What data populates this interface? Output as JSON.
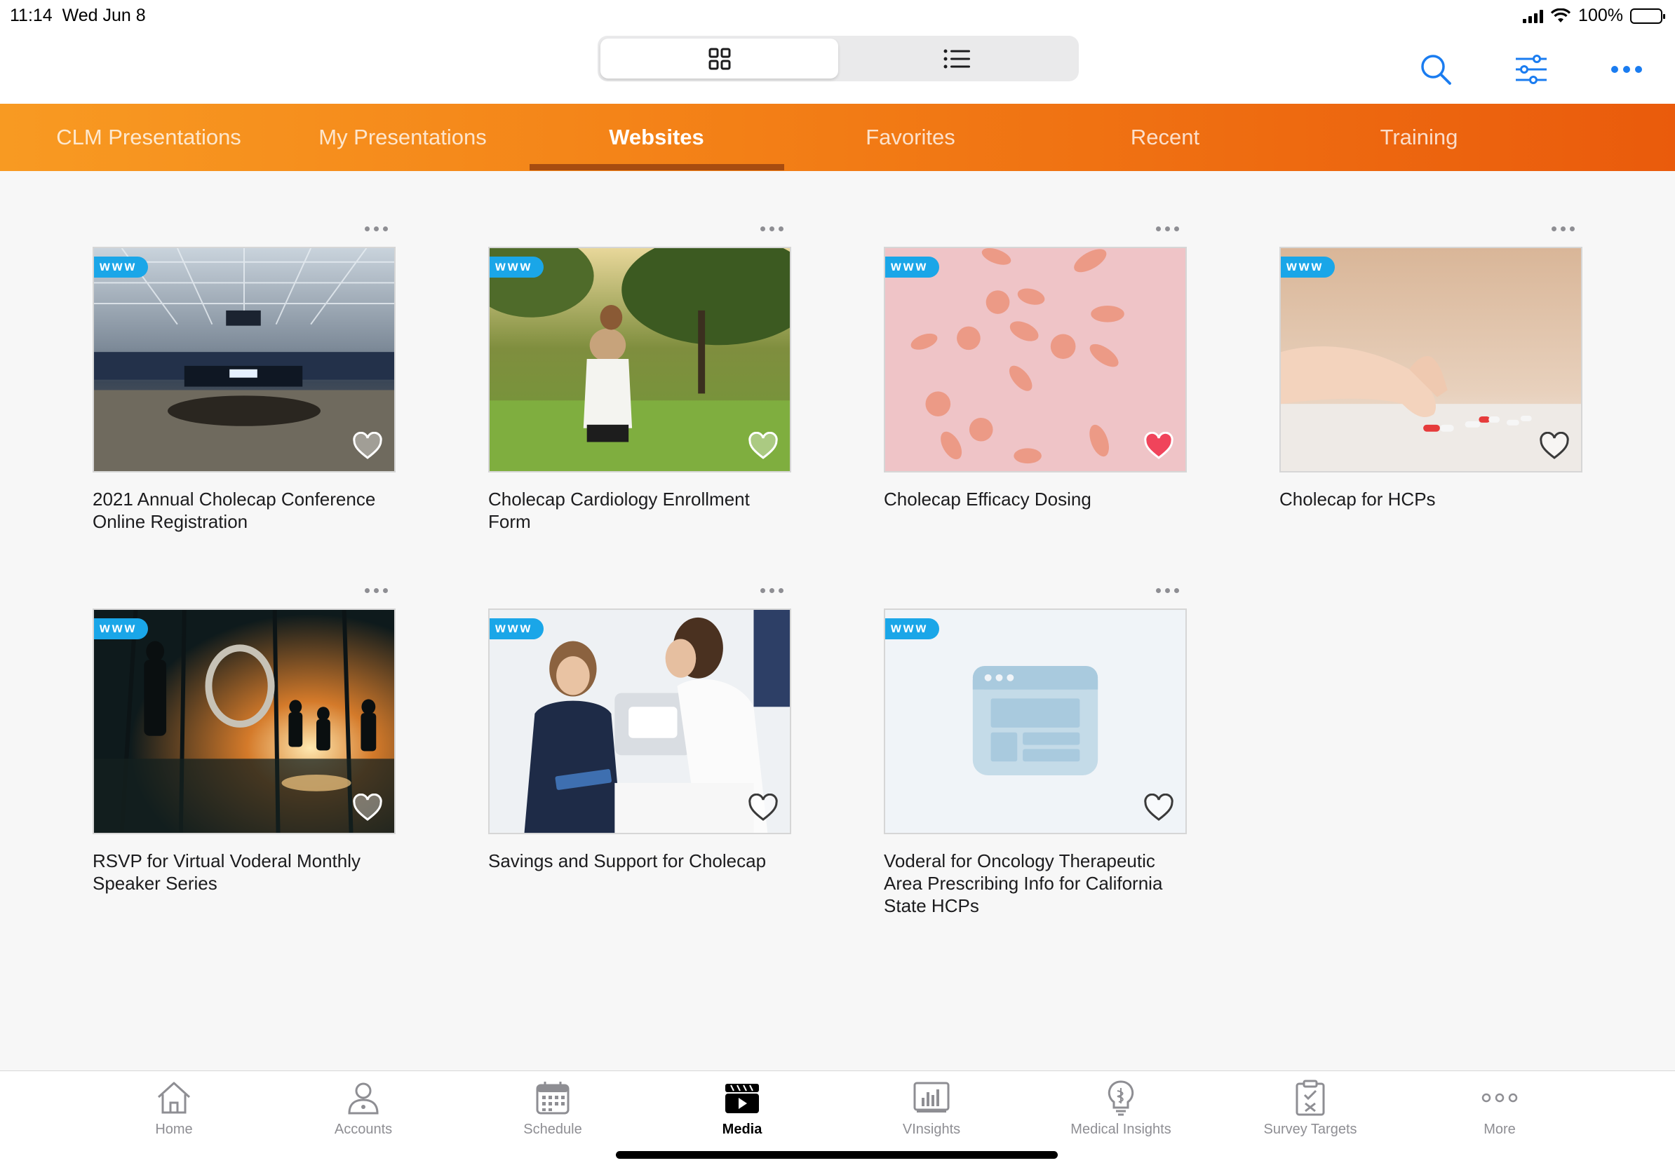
{
  "status": {
    "time": "11:14",
    "date": "Wed Jun 8",
    "battery": "100%"
  },
  "view_toggle": {
    "grid_icon": "grid-icon",
    "list_icon": "list-icon",
    "selected": "grid"
  },
  "header_actions": {
    "search_icon": "search-icon",
    "filter_icon": "sliders-icon",
    "more_icon": "ellipsis-icon",
    "accent": "#1a7cf0"
  },
  "tabs": [
    {
      "label": "CLM Presentations"
    },
    {
      "label": "My Presentations"
    },
    {
      "label": "Websites",
      "active": true
    },
    {
      "label": "Favorites"
    },
    {
      "label": "Recent"
    },
    {
      "label": "Training"
    }
  ],
  "badge_label": "www",
  "cards": [
    {
      "title": "2021 Annual Cholecap Conference Online Registration",
      "image": "stadium-photo",
      "favorite": false
    },
    {
      "title": "Cholecap Cardiology Enrollment Form",
      "image": "runner-in-park-photo",
      "favorite": false
    },
    {
      "title": "Cholecap Efficacy Dosing",
      "image": "pills-on-pink-photo",
      "favorite": true
    },
    {
      "title": "Cholecap for HCPs",
      "image": "hand-with-capsules-photo",
      "favorite": false
    },
    {
      "title": "RSVP for Virtual Voderal Monthly Speaker Series",
      "image": "event-silhouettes-photo",
      "favorite": false
    },
    {
      "title": "Savings and Support for Cholecap",
      "image": "clinic-consultation-photo",
      "favorite": false
    },
    {
      "title": "Voderal for Oncology Therapeutic Area Prescribing Info for California State HCPs",
      "image": "website-placeholder-icon",
      "favorite": false
    }
  ],
  "bottom_nav": [
    {
      "label": "Home",
      "icon": "home-icon"
    },
    {
      "label": "Accounts",
      "icon": "person-icon"
    },
    {
      "label": "Schedule",
      "icon": "calendar-icon"
    },
    {
      "label": "Media",
      "icon": "media-clapper-icon",
      "active": true
    },
    {
      "label": "VInsights",
      "icon": "bar-chart-icon"
    },
    {
      "label": "Medical Insights",
      "icon": "lightbulb-icon"
    },
    {
      "label": "Survey Targets",
      "icon": "clipboard-check-icon"
    },
    {
      "label": "More",
      "icon": "more-dots-icon"
    }
  ],
  "colors": {
    "tab_start": "#f89a22",
    "tab_end": "#ea5b0c",
    "badge": "#1aa6e8",
    "favorite_heart": "#f0445b"
  }
}
